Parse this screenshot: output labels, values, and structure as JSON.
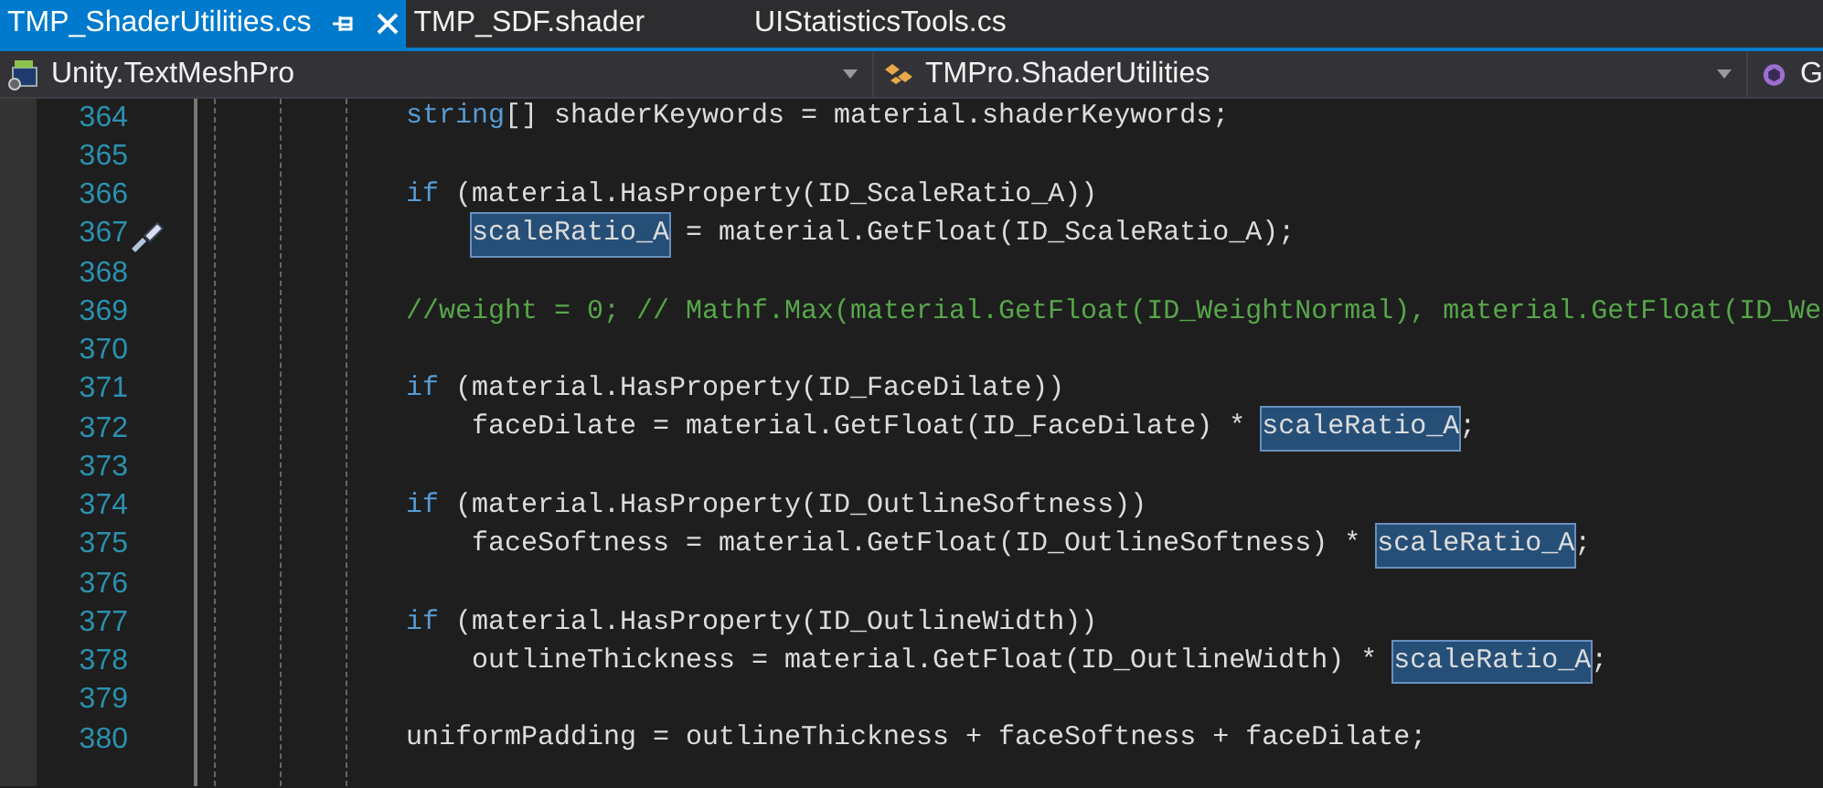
{
  "tabs": [
    {
      "label": "TMP_ShaderUtilities.cs",
      "selected": true,
      "pinned": true,
      "closable": true
    },
    {
      "label": "TMP_SDF.shader",
      "selected": false,
      "pinned": false,
      "closable": false
    },
    {
      "label": "UIStatisticsTools.cs",
      "selected": false,
      "pinned": false,
      "closable": false
    }
  ],
  "navigation_bar": {
    "project": "Unity.TextMeshPro",
    "type": "TMPro.ShaderUtilities",
    "member": "G"
  },
  "lines": [
    {
      "number": "364",
      "nested": false,
      "quick_action": false,
      "tokens": [
        {
          "kind": "keyword",
          "text": "string"
        },
        {
          "kind": "plain",
          "text": "[] shaderKeywords = material.shaderKeywords;"
        }
      ]
    },
    {
      "number": "365",
      "nested": false,
      "quick_action": false
    },
    {
      "number": "366",
      "nested": false,
      "quick_action": false,
      "tokens": [
        {
          "kind": "keyword",
          "text": "if"
        },
        {
          "kind": "plain",
          "text": " (material.HasProperty(ID_ScaleRatio_A))"
        }
      ]
    },
    {
      "number": "367",
      "nested": true,
      "quick_action": true,
      "tokens": [
        {
          "kind": "highlight",
          "text": "scaleRatio_A"
        },
        {
          "kind": "plain",
          "text": " = material.GetFloat(ID_ScaleRatio_A);"
        }
      ]
    },
    {
      "number": "368",
      "nested": false,
      "quick_action": false
    },
    {
      "number": "369",
      "nested": false,
      "quick_action": false,
      "tokens": [
        {
          "kind": "comment",
          "text": "//weight = 0; // Mathf.Max(material.GetFloat(ID_WeightNormal), material.GetFloat(ID_We"
        }
      ]
    },
    {
      "number": "370",
      "nested": false,
      "quick_action": false
    },
    {
      "number": "371",
      "nested": false,
      "quick_action": false,
      "tokens": [
        {
          "kind": "keyword",
          "text": "if"
        },
        {
          "kind": "plain",
          "text": " (material.HasProperty(ID_FaceDilate))"
        }
      ]
    },
    {
      "number": "372",
      "nested": true,
      "quick_action": false,
      "tokens": [
        {
          "kind": "plain",
          "text": "faceDilate = material.GetFloat(ID_FaceDilate) * "
        },
        {
          "kind": "highlight",
          "text": "scaleRatio_A"
        },
        {
          "kind": "plain",
          "text": ";"
        }
      ]
    },
    {
      "number": "373",
      "nested": false,
      "quick_action": false
    },
    {
      "number": "374",
      "nested": false,
      "quick_action": false,
      "tokens": [
        {
          "kind": "keyword",
          "text": "if"
        },
        {
          "kind": "plain",
          "text": " (material.HasProperty(ID_OutlineSoftness))"
        }
      ]
    },
    {
      "number": "375",
      "nested": true,
      "quick_action": false,
      "tokens": [
        {
          "kind": "plain",
          "text": "faceSoftness = material.GetFloat(ID_OutlineSoftness) * "
        },
        {
          "kind": "highlight",
          "text": "scaleRatio_A"
        },
        {
          "kind": "plain",
          "text": ";"
        }
      ]
    },
    {
      "number": "376",
      "nested": false,
      "quick_action": false
    },
    {
      "number": "377",
      "nested": false,
      "quick_action": false,
      "tokens": [
        {
          "kind": "keyword",
          "text": "if"
        },
        {
          "kind": "plain",
          "text": " (material.HasProperty(ID_OutlineWidth))"
        }
      ]
    },
    {
      "number": "378",
      "nested": true,
      "quick_action": false,
      "tokens": [
        {
          "kind": "plain",
          "text": "outlineThickness = material.GetFloat(ID_OutlineWidth) * "
        },
        {
          "kind": "highlight",
          "text": "scaleRatio_A"
        },
        {
          "kind": "plain",
          "text": ";"
        }
      ]
    },
    {
      "number": "379",
      "nested": false,
      "quick_action": false
    },
    {
      "number": "380",
      "nested": false,
      "quick_action": false,
      "tokens": [
        {
          "kind": "plain",
          "text": "uniformPadding = outlineThickness + faceSoftness + faceDilate;"
        }
      ]
    }
  ]
}
